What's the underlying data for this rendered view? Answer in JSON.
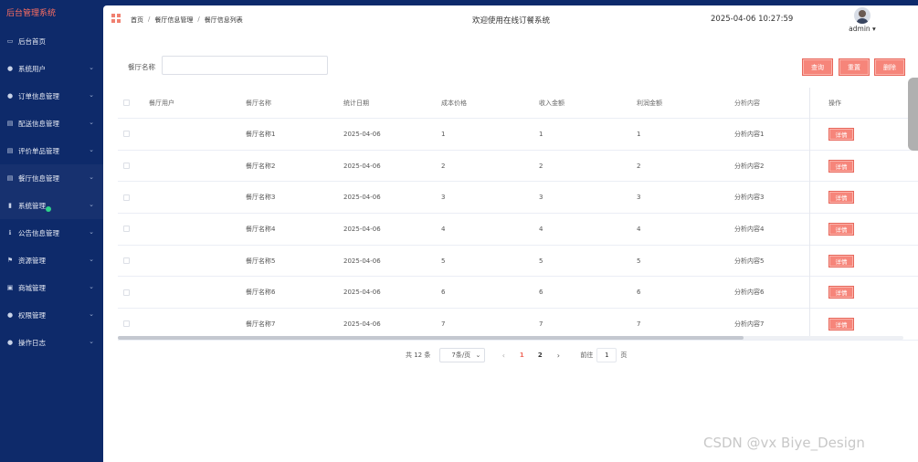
{
  "sidebar": {
    "brand": "后台管理系统",
    "items": [
      {
        "label": "后台首页",
        "icon": "monitor-icon",
        "chevron": false
      },
      {
        "label": "系统用户",
        "icon": "user-icon",
        "chevron": true
      },
      {
        "label": "订单信息管理",
        "icon": "user-icon",
        "chevron": true
      },
      {
        "label": "配送信息管理",
        "icon": "doc-icon",
        "chevron": true
      },
      {
        "label": "评价单品管理",
        "icon": "doc-icon",
        "chevron": true
      },
      {
        "label": "餐厅信息管理",
        "icon": "doc-icon",
        "chevron": true
      },
      {
        "label": "系统管理",
        "icon": "chart-icon",
        "chevron": true
      },
      {
        "label": "公告信息管理",
        "icon": "info-icon",
        "chevron": true
      },
      {
        "label": "资源管理",
        "icon": "flag-icon",
        "chevron": true
      },
      {
        "label": "商城管理",
        "icon": "cart-icon",
        "chevron": true
      },
      {
        "label": "权限管理",
        "icon": "user-icon",
        "chevron": true
      },
      {
        "label": "操作日志",
        "icon": "user-icon",
        "chevron": true
      }
    ]
  },
  "topbar": {
    "breadcrumb": [
      "首页",
      "餐厅信息管理",
      "餐厅信息列表"
    ],
    "welcome": "欢迎使用在线订餐系统",
    "datetime": "2025-04-06 10:27:59",
    "user": "admin ▾"
  },
  "search": {
    "label": "餐厅名称",
    "value": ""
  },
  "buttons": {
    "query": "查询",
    "reset": "重置",
    "delete": "删除"
  },
  "table": {
    "headers": [
      "餐厅用户",
      "餐厅名称",
      "统计日期",
      "成本价格",
      "收入金额",
      "利润金额",
      "分析内容",
      "操作"
    ],
    "detail_label": "详情",
    "rows": [
      [
        "",
        "餐厅名称1",
        "2025-04-06",
        "1",
        "1",
        "1",
        "分析内容1"
      ],
      [
        "",
        "餐厅名称2",
        "2025-04-06",
        "2",
        "2",
        "2",
        "分析内容2"
      ],
      [
        "",
        "餐厅名称3",
        "2025-04-06",
        "3",
        "3",
        "3",
        "分析内容3"
      ],
      [
        "",
        "餐厅名称4",
        "2025-04-06",
        "4",
        "4",
        "4",
        "分析内容4"
      ],
      [
        "",
        "餐厅名称5",
        "2025-04-06",
        "5",
        "5",
        "5",
        "分析内容5"
      ],
      [
        "",
        "餐厅名称6",
        "2025-04-06",
        "6",
        "6",
        "6",
        "分析内容6"
      ],
      [
        "",
        "餐厅名称7",
        "2025-04-06",
        "7",
        "7",
        "7",
        "分析内容7"
      ]
    ]
  },
  "pagination": {
    "total": "共 12 条",
    "page_size": "7条/页",
    "pages": [
      "1",
      "2"
    ],
    "goto_prefix": "前往",
    "goto_value": "1",
    "goto_suffix": "页"
  },
  "watermark": "CSDN @vx Biye_Design",
  "colors": {
    "sidebar_bg": "#0e2a6a",
    "accent": "#f6857a",
    "brand_text": "#ff6f61"
  }
}
